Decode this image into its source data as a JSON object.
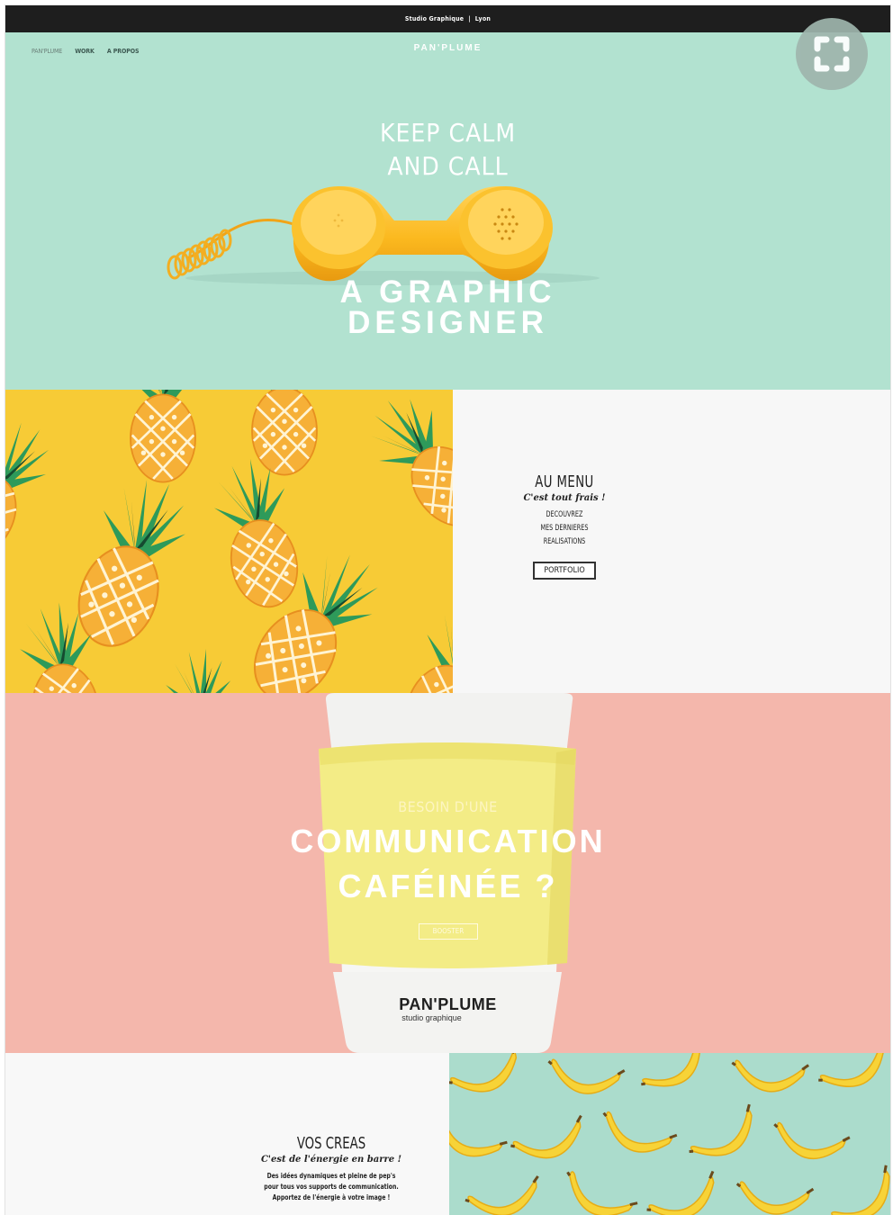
{
  "topbar": {
    "left": "Studio Graphique",
    "separator": "|",
    "right": "Lyon"
  },
  "nav": {
    "items": [
      "PAN'PLUME",
      "WORK",
      "A PROPOS"
    ]
  },
  "hero": {
    "brand": "PAN'PLUME",
    "headline_line1": "KEEP CALM",
    "headline_line2": "AND CALL",
    "title_line1": "A GRAPHIC",
    "title_line2": "DESIGNER",
    "background": "#b2e2d0"
  },
  "menu_section": {
    "title": "AU MENU",
    "subtitle": "C'est tout frais !",
    "text_line1": "DECOUVREZ",
    "text_line2": "MES DERNIERES",
    "text_line3": "REALISATIONS",
    "button": "PORTFOLIO",
    "pattern_color": "#f7cb36"
  },
  "coffee_section": {
    "pre_title": "BESOIN D'UNE",
    "title_line1": "COMMUNICATION",
    "title_line2": "CAFÉINÉE ?",
    "button": "BOOSTER",
    "cup_brand": "PAN'PLUME",
    "cup_subtitle": "studio graphique",
    "background": "#f4b7ac"
  },
  "creas_section": {
    "title": "VOS CREAS",
    "subtitle": "C'est de l'énergie en barre !",
    "text_line1": "Des idées dynamiques et pleine de pep's",
    "text_line2": "pour tous vos supports de communication.",
    "text_line3": "Apportez de l'énergie à votre image !",
    "pattern_color": "#abdccc"
  },
  "overlay": {
    "icon": "expand-icon"
  }
}
